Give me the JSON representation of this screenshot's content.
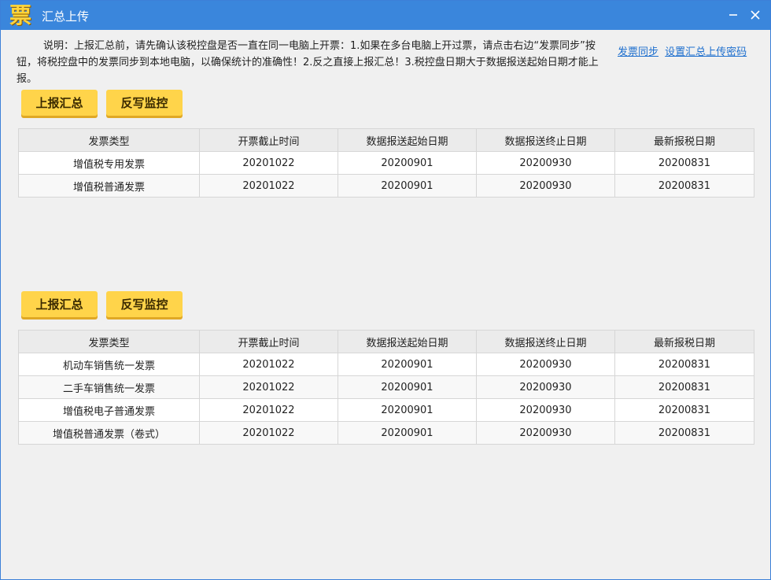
{
  "window": {
    "icon_glyph": "票",
    "title": "汇总上传",
    "minimize_icon": "minimize-icon",
    "close_icon": "close-icon"
  },
  "description": "说明：上报汇总前，请先确认该税控盘是否一直在同一电脑上开票：1.如果在多台电脑上开过票，请点击右边“发票同步”按钮，将税控盘中的发票同步到本地电脑，以确保统计的准确性！2.反之直接上报汇总！3.税控盘日期大于数据报送起始日期才能上报。",
  "links": {
    "sync": "发票同步",
    "password": "设置汇总上传密码"
  },
  "section1": {
    "report_button": "上报汇总",
    "writeback_button": "反写监控",
    "columns": [
      "发票类型",
      "开票截止时间",
      "数据报送起始日期",
      "数据报送终止日期",
      "最新报税日期"
    ],
    "rows": [
      [
        "增值税专用发票",
        "20201022",
        "20200901",
        "20200930",
        "20200831"
      ],
      [
        "增值税普通发票",
        "20201022",
        "20200901",
        "20200930",
        "20200831"
      ]
    ]
  },
  "section2": {
    "report_button": "上报汇总",
    "writeback_button": "反写监控",
    "columns": [
      "发票类型",
      "开票截止时间",
      "数据报送起始日期",
      "数据报送终止日期",
      "最新报税日期"
    ],
    "rows": [
      [
        "机动车销售统一发票",
        "20201022",
        "20200901",
        "20200930",
        "20200831"
      ],
      [
        "二手车销售统一发票",
        "20201022",
        "20200901",
        "20200930",
        "20200831"
      ],
      [
        "增值税电子普通发票",
        "20201022",
        "20200901",
        "20200930",
        "20200831"
      ],
      [
        "增值税普通发票（卷式）",
        "20201022",
        "20200901",
        "20200930",
        "20200831"
      ]
    ]
  },
  "colors": {
    "titlebar": "#3a86dc",
    "button": "#ffd44a",
    "link": "#1e6fce"
  }
}
